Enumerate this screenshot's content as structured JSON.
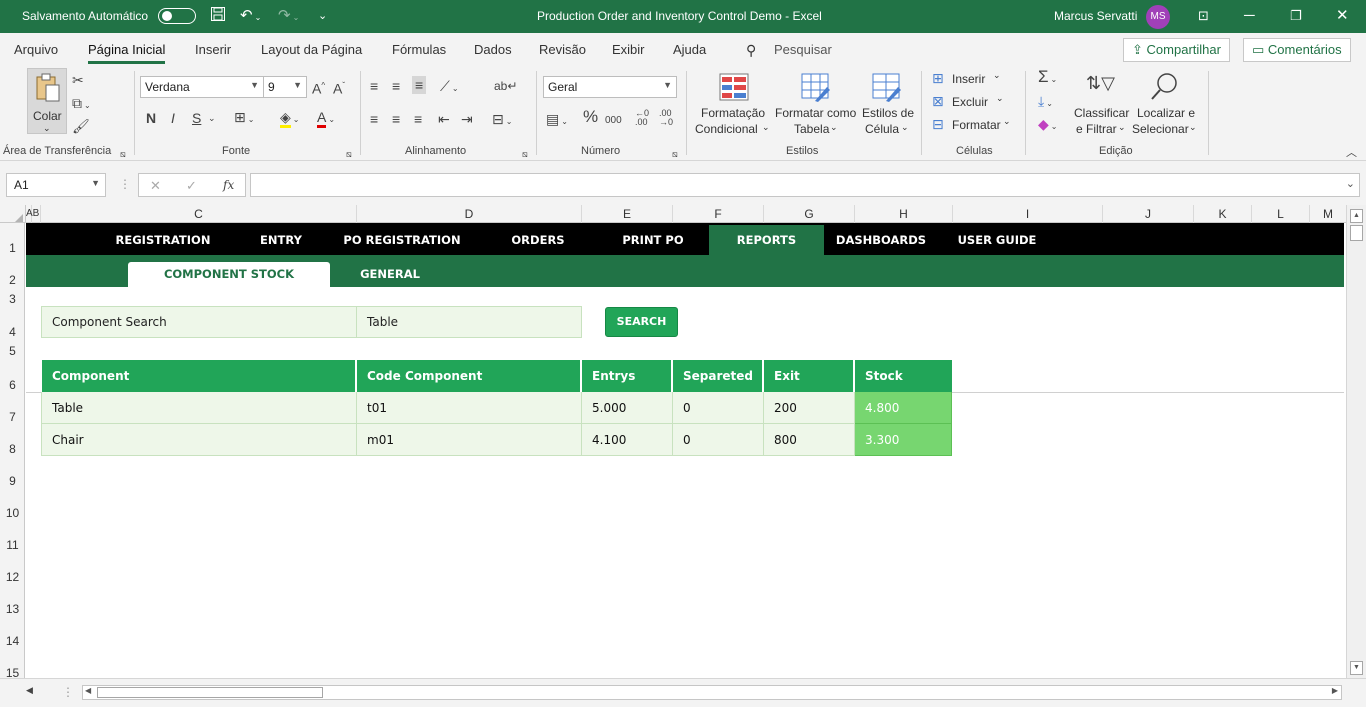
{
  "titlebar": {
    "autosave_label": "Salvamento Automático",
    "doc_title": "Production Order and Inventory Control Demo  -  Excel",
    "user_name": "Marcus Servatti",
    "user_initials": "MS"
  },
  "menu": {
    "tabs": [
      "Arquivo",
      "Página Inicial",
      "Inserir",
      "Layout da Página",
      "Fórmulas",
      "Dados",
      "Revisão",
      "Exibir",
      "Ajuda"
    ],
    "search_placeholder": "Pesquisar",
    "share_label": "Compartilhar",
    "comments_label": "Comentários"
  },
  "ribbon": {
    "clipboard": {
      "paste_label": "Colar",
      "group_label": "Área de Transferência"
    },
    "font": {
      "name": "Verdana",
      "size": "9",
      "group_label": "Fonte",
      "bold": "N",
      "italic": "I",
      "underline": "S"
    },
    "alignment": {
      "group_label": "Alinhamento"
    },
    "number": {
      "format": "Geral",
      "group_label": "Número"
    },
    "styles": {
      "cond_format_1": "Formatação",
      "cond_format_2": "Condicional",
      "format_table_1": "Formatar como",
      "format_table_2": "Tabela",
      "cell_styles_1": "Estilos de",
      "cell_styles_2": "Célula",
      "group_label": "Estilos"
    },
    "cells": {
      "insert": "Inserir",
      "delete": "Excluir",
      "format": "Formatar",
      "group_label": "Células"
    },
    "editing": {
      "sort_1": "Classificar",
      "sort_2": "e Filtrar",
      "find_1": "Localizar e",
      "find_2": "Selecionar",
      "group_label": "Edição"
    }
  },
  "formula_bar": {
    "name_box": "A1",
    "fx_label": "fx",
    "content": ""
  },
  "columns": [
    "A",
    "B",
    "C",
    "D",
    "E",
    "F",
    "G",
    "H",
    "I",
    "J",
    "K",
    "L",
    "M"
  ],
  "rows": [
    "1",
    "2",
    "3",
    "4",
    "5",
    "6",
    "7",
    "8",
    "9",
    "10",
    "11",
    "12",
    "13",
    "14",
    "15"
  ],
  "sheet": {
    "nav": [
      "REGISTRATION",
      "ENTRY",
      "PO REGISTRATION",
      "ORDERS",
      "PRINT PO",
      "REPORTS",
      "DASHBOARDS",
      "USER GUIDE"
    ],
    "subtabs": [
      "COMPONENT STOCK",
      "GENERAL"
    ],
    "search": {
      "label": "Component Search",
      "value": "Table",
      "button": "SEARCH"
    },
    "table": {
      "headers": [
        "Component",
        "Code Component",
        "Entrys",
        "Separeted",
        "Exit",
        "Stock"
      ],
      "rows": [
        [
          "Table",
          "t01",
          "5.000",
          "0",
          "200",
          "4.800"
        ],
        [
          "Chair",
          "m01",
          "4.100",
          "0",
          "800",
          "3.300"
        ]
      ]
    }
  },
  "colors": {
    "excel_green": "#217346",
    "header_green": "#21a558",
    "row_bg": "#eef7e9",
    "stock_bg": "#77d670"
  }
}
